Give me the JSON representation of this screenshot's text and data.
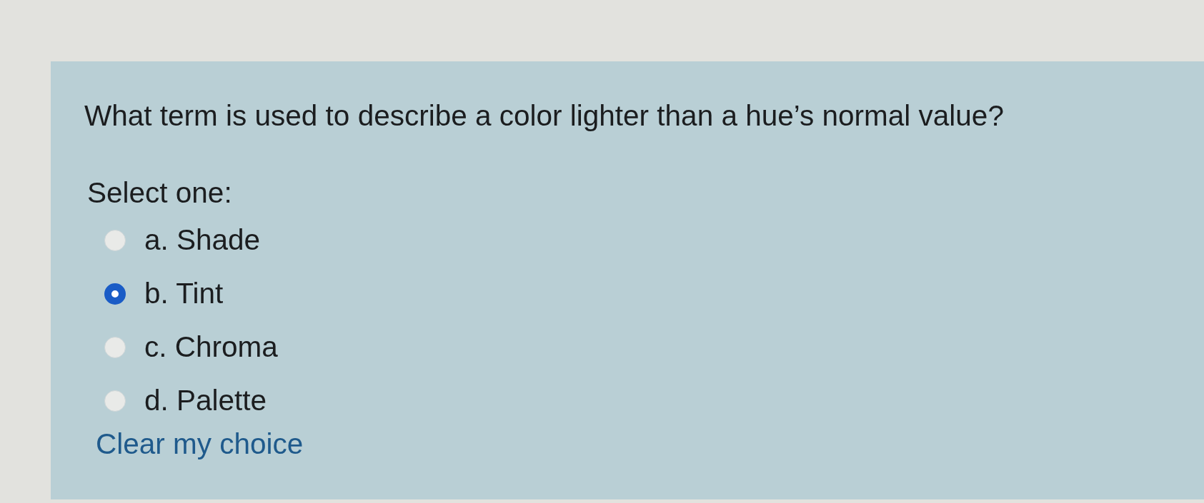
{
  "question": {
    "text": "What term is used to describe a color lighter than a hue’s normal value?",
    "prompt": "Select one:",
    "options": [
      {
        "label": "a. Shade",
        "selected": false
      },
      {
        "label": "b. Tint",
        "selected": true
      },
      {
        "label": "c. Chroma",
        "selected": false
      },
      {
        "label": "d. Palette",
        "selected": false
      }
    ],
    "clear_link": "Clear my choice"
  }
}
